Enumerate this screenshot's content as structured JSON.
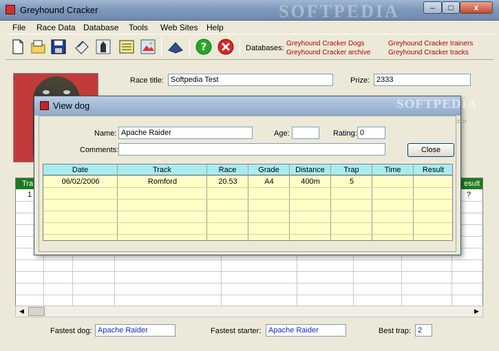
{
  "window": {
    "title": "Greyhound Cracker",
    "watermark": "SOFTPEDIA",
    "min": "–",
    "max": "□",
    "close": "x"
  },
  "menu": [
    "File",
    "Race Data",
    "Database",
    "Tools",
    "Web Sites",
    "Help"
  ],
  "toolbar": {
    "databases_label": "Databases:",
    "links": [
      "Greyhound Cracker Dogs",
      "Greyhound Cracker archive",
      "Greyhound Cracker trainers",
      "Greyhound Cracker tracks"
    ]
  },
  "race": {
    "title_label": "Race title:",
    "title_value": "Softpedia Test",
    "prize_label": "Prize:",
    "prize_value": "2333"
  },
  "grid_bg": {
    "first_col": "Tra",
    "last_col": "esult",
    "row1_first": "1",
    "row1_last": "?"
  },
  "footer": {
    "fastest_dog_label": "Fastest dog:",
    "fastest_dog": "Apache Raider",
    "fastest_starter_label": "Fastest starter:",
    "fastest_starter": "Apache Raider",
    "best_trap_label": "Best trap:",
    "best_trap": "2"
  },
  "dialog": {
    "title": "View dog",
    "watermark": "SOFTPEDIA",
    "watermark_url": "www.softpedia.com",
    "name_label": "Name:",
    "name_value": "Apache Raider",
    "age_label": "Age:",
    "age_value": "",
    "rating_label": "Rating:",
    "rating_value": "0",
    "comments_label": "Comments:",
    "comments_value": "",
    "close_label": "Close",
    "columns": [
      "Date",
      "Track",
      "Race",
      "Grade",
      "Distance",
      "Trap",
      "Time",
      "Result"
    ],
    "rows": [
      [
        "06/02/2006",
        "Romford",
        "20.53",
        "A4",
        "400m",
        "5",
        "",
        ""
      ]
    ]
  }
}
